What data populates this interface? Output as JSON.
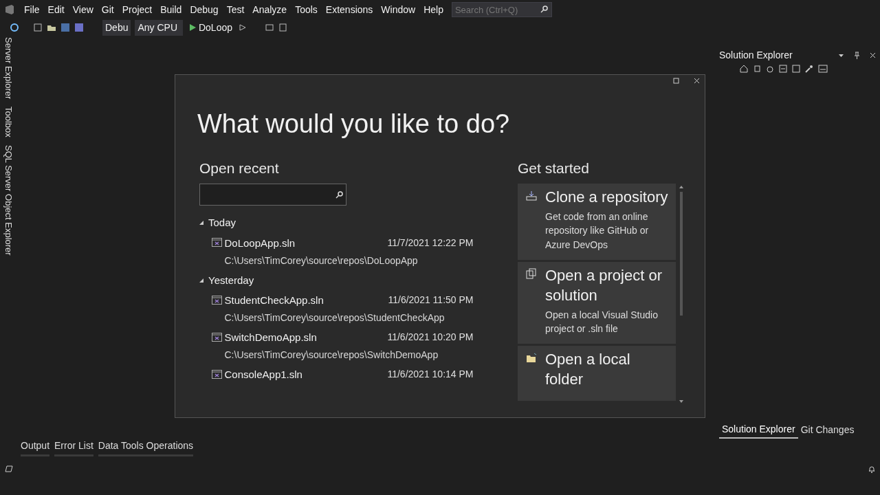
{
  "menu": [
    "File",
    "Edit",
    "View",
    "Git",
    "Project",
    "Build",
    "Debug",
    "Test",
    "Analyze",
    "Tools",
    "Extensions",
    "Window",
    "Help"
  ],
  "search": {
    "placeholder": "Search (Ctrl+Q)"
  },
  "toolbar": {
    "configuration": "Debu",
    "platform": "Any CPU",
    "start": "DoLoop"
  },
  "side_tabs": [
    "Server Explorer",
    "Toolbox",
    "SQL Server Object Explorer"
  ],
  "dialog": {
    "title": "What would you like to do?",
    "open_recent": {
      "heading": "Open recent",
      "groups": [
        {
          "label": "Today",
          "expanded": true,
          "items": [
            {
              "name": "DoLoopApp.sln",
              "date": "11/7/2021 12:22 PM",
              "path": "C:\\Users\\TimCorey\\source\\repos\\DoLoopApp"
            }
          ]
        },
        {
          "label": "Yesterday",
          "expanded": true,
          "items": [
            {
              "name": "StudentCheckApp.sln",
              "date": "11/6/2021 11:50 PM",
              "path": "C:\\Users\\TimCorey\\source\\repos\\StudentCheckApp"
            },
            {
              "name": "SwitchDemoApp.sln",
              "date": "11/6/2021 10:20 PM",
              "path": "C:\\Users\\TimCorey\\source\\repos\\SwitchDemoApp"
            },
            {
              "name": "ConsoleApp1.sln",
              "date": "11/6/2021 10:14 PM"
            }
          ]
        }
      ]
    },
    "get_started": {
      "heading": "Get started",
      "cards": [
        {
          "kind": "clone",
          "title": "Clone a repository",
          "description": "Get code from an online repository like GitHub or Azure DevOps"
        },
        {
          "kind": "project",
          "title": "Open a project or solution",
          "description": "Open a local Visual Studio project or .sln file"
        },
        {
          "kind": "folder",
          "title": "Open a local folder"
        }
      ]
    }
  },
  "solution_explorer": {
    "title": "Solution Explorer"
  },
  "right_tabs": [
    {
      "label": "Solution Explorer",
      "selected": true
    },
    {
      "label": "Git Changes",
      "selected": false
    }
  ],
  "bottom_tabs": [
    "Output",
    "Error List",
    "Data Tools Operations"
  ]
}
